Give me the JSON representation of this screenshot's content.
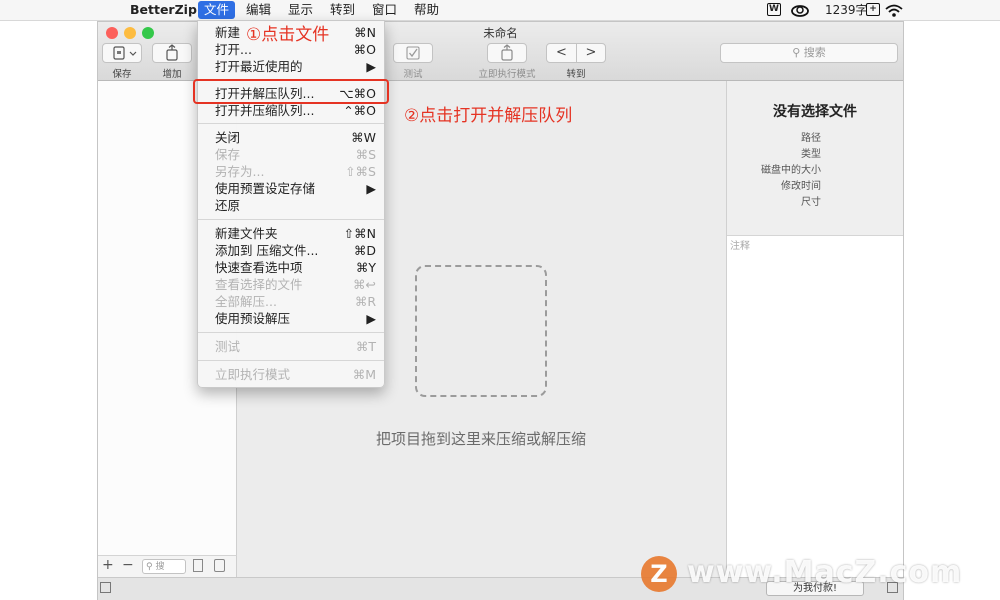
{
  "menubar": {
    "apple": "",
    "app_name": "BetterZip",
    "items": [
      "文件",
      "编辑",
      "显示",
      "转到",
      "窗口",
      "帮助"
    ],
    "word_count": "1239字"
  },
  "window": {
    "title": "未命名",
    "toolbar": {
      "save": "保存",
      "add": "增加",
      "test": "测试",
      "run_now": "立即执行模式",
      "goto": "转到",
      "back": "<",
      "forward": ">",
      "search_placeholder": "搜索"
    },
    "drop_text": "把项目拖到这里来压缩或解压缩",
    "sidebar": {
      "add": "+",
      "remove": "−",
      "search_placeholder": "搜"
    },
    "info": {
      "title": "没有选择文件",
      "fields": [
        "路径",
        "类型",
        "磁盘中的大小",
        "修改时间",
        "尺寸"
      ],
      "notes": "注释"
    },
    "donate": "为我付款!"
  },
  "file_menu": {
    "items": [
      {
        "label": "新建",
        "shortcut": "⌘N",
        "disabled": false
      },
      {
        "label": "打开...",
        "shortcut": "⌘O",
        "disabled": false
      },
      {
        "label": "打开最近使用的",
        "shortcut": "▶",
        "disabled": false
      },
      {
        "label": "打开并解压队列...",
        "shortcut": "⌥⌘O",
        "disabled": false
      },
      {
        "label": "打开并压缩队列...",
        "shortcut": "⌃⌘O",
        "disabled": false
      },
      {
        "label": "关闭",
        "shortcut": "⌘W",
        "disabled": false
      },
      {
        "label": "保存",
        "shortcut": "⌘S",
        "disabled": true
      },
      {
        "label": "另存为...",
        "shortcut": "⇧⌘S",
        "disabled": true
      },
      {
        "label": "使用预置设定存储",
        "shortcut": "▶",
        "disabled": false
      },
      {
        "label": "还原",
        "shortcut": "",
        "disabled": false
      },
      {
        "label": "新建文件夹",
        "shortcut": "⇧⌘N",
        "disabled": false
      },
      {
        "label": "添加到 压缩文件...",
        "shortcut": "⌘D",
        "disabled": false
      },
      {
        "label": "快速查看选中项",
        "shortcut": "⌘Y",
        "disabled": false
      },
      {
        "label": "查看选择的文件",
        "shortcut": "⌘↩",
        "disabled": true
      },
      {
        "label": "全部解压...",
        "shortcut": "⌘R",
        "disabled": true
      },
      {
        "label": "使用预设解压",
        "shortcut": "▶",
        "disabled": false
      },
      {
        "label": "测试",
        "shortcut": "⌘T",
        "disabled": true
      },
      {
        "label": "立即执行模式",
        "shortcut": "⌘M",
        "disabled": true
      }
    ]
  },
  "annotations": {
    "step1": "①点击文件",
    "step2": "②点击打开并解压队列"
  },
  "watermark": {
    "logo": "Z",
    "text": "www.MacZ.com"
  },
  "colors": {
    "menu_highlight": "#2f6fe4",
    "annotation": "#e53323",
    "traffic_close": "#fc605b",
    "traffic_min": "#fdbc40",
    "traffic_zoom": "#34c84a"
  }
}
